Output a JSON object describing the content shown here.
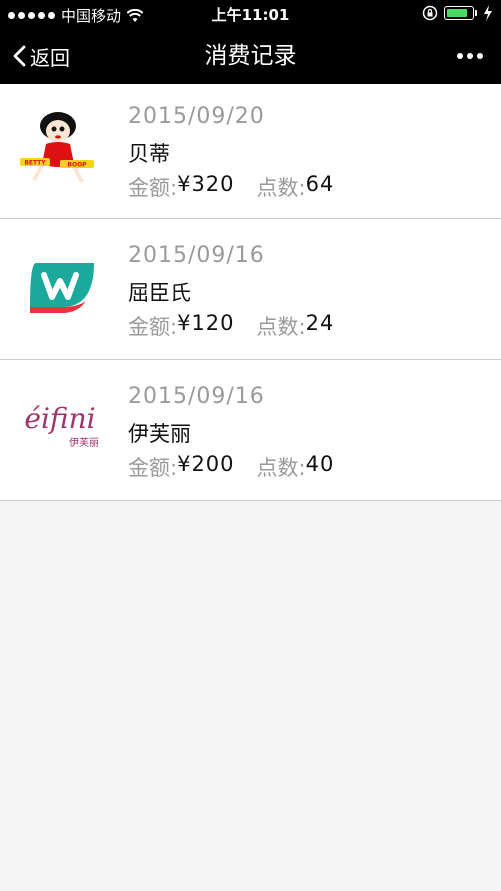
{
  "statusbar": {
    "carrier": "中国移动",
    "time": "上午11:01"
  },
  "navbar": {
    "back_label": "返回",
    "title": "消费记录"
  },
  "records": [
    {
      "date": "2015/09/20",
      "store": "贝蒂",
      "amount_label": "金额:",
      "amount": "¥320",
      "points_label": "点数:",
      "points": "64",
      "logo_text": "BETTY BOOP"
    },
    {
      "date": "2015/09/16",
      "store": "屈臣氏",
      "amount_label": "金额:",
      "amount": "¥120",
      "points_label": "点数:",
      "points": "24",
      "logo_text": "w"
    },
    {
      "date": "2015/09/16",
      "store": "伊芙丽",
      "amount_label": "金额:",
      "amount": "¥200",
      "points_label": "点数:",
      "points": "40",
      "logo_text": "éifini",
      "logo_subtext": "伊芙丽"
    }
  ],
  "colors": {
    "navbar_bg": "#000000",
    "watsons_teal": "#1aa99a",
    "watsons_red": "#e5343d",
    "eifini_magenta": "#a0346b",
    "battery_green": "#4cd964"
  }
}
